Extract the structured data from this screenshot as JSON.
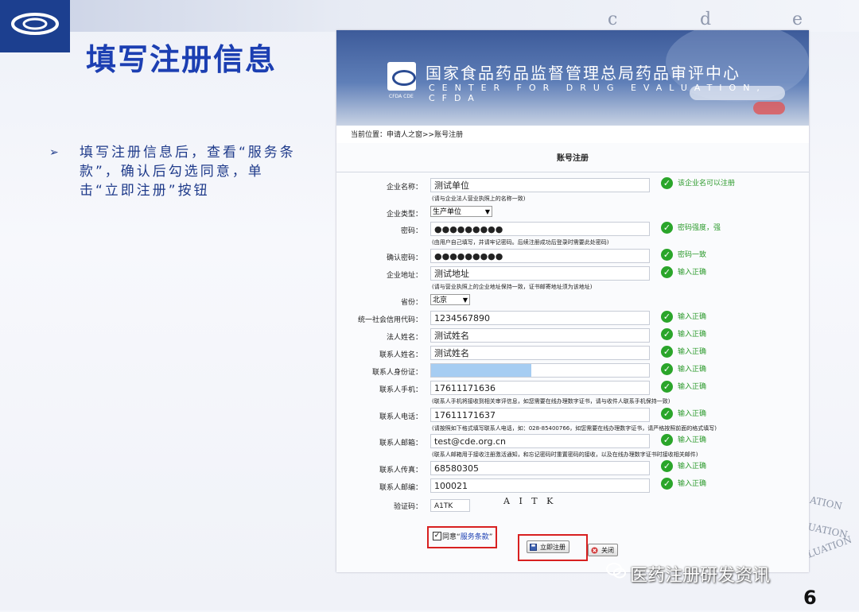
{
  "slide": {
    "title": "填写注册信息",
    "bullet": "填写注册信息后，查看“服务条款”，确认后勾选同意，单击“立即注册”按钮",
    "watermark_letters": [
      "c",
      "d",
      "e"
    ],
    "corner_words": [
      "ATION",
      "LUATION",
      "VALUATION"
    ],
    "wechat_label": "医药注册研发资讯",
    "page_number": "6"
  },
  "site": {
    "name_cn": "国家食品药品监督管理总局药品审评中心",
    "name_en": "CENTER FOR DRUG EVALUATION, CFDA",
    "logo_caption": "CFDA CDE",
    "breadcrumb": "当前位置：申请人之窗>>账号注册"
  },
  "form": {
    "title": "账号注册",
    "fields": [
      {
        "label": "企业名称：",
        "value": "测试单位",
        "hint": "(请与企业法人营业执照上的名称一致)",
        "status": "该企业名可以注册"
      },
      {
        "label": "企业类型：",
        "value": "生产单位",
        "type": "select"
      },
      {
        "label": "密码：",
        "value": "●●●●●●●●●",
        "hint": "(由用户自己填写，并请牢记密码。后续注册成功后登录时需要此处密码)",
        "status": "密码强度，强"
      },
      {
        "label": "确认密码：",
        "value": "●●●●●●●●●",
        "status": "密码一致"
      },
      {
        "label": "企业地址：",
        "value": "测试地址",
        "hint": "(请与营业执照上的企业地址保持一致，证书邮寄地址须为该地址)",
        "status": "输入正确"
      },
      {
        "label": "省份：",
        "value": "北京",
        "type": "select"
      },
      {
        "label": "统一社会信用代码：",
        "value": "1234567890",
        "status": "输入正确"
      },
      {
        "label": "法人姓名：",
        "value": "测试姓名",
        "status": "输入正确"
      },
      {
        "label": "联系人姓名：",
        "value": "测试姓名",
        "status": "输入正确"
      },
      {
        "label": "联系人身份证：",
        "value": "",
        "redacted": true,
        "status": "输入正确"
      },
      {
        "label": "联系人手机：",
        "value": "17611171636",
        "hint": "(联系人手机将接收到相关审评信息，如您需要在线办理数字证书，请与收件人联系手机保持一致)",
        "status": "输入正确"
      },
      {
        "label": "联系人电话：",
        "value": "17611171637",
        "hint": "(请按照如下格式填写联系人电话，如：028-85400766，如您需要在线办理数字证书，请严格按照前面的格式填写)",
        "status": "输入正确"
      },
      {
        "label": "联系人邮箱：",
        "value": "test@cde.org.cn",
        "hint": "(联系人邮箱用于接收注册激活通知，和忘记密码时重置密码的接收，以及在线办理数字证书时接收相关邮件)",
        "status": "输入正确"
      },
      {
        "label": "联系人传真：",
        "value": "68580305",
        "status": "输入正确"
      },
      {
        "label": "联系人邮编：",
        "value": "100021",
        "status": "输入正确"
      }
    ],
    "captcha_label": "验证码：",
    "captcha_value": "A1TK",
    "captcha_image_text": "A I T K",
    "agree_prefix": "同意",
    "agree_link": "服务条款",
    "submit_label": "立即注册",
    "close_label": "关闭",
    "check_glyph": "✓",
    "agree_mark": "✓",
    "select_arrow": "▼"
  },
  "colors": {
    "title_blue": "#1c3fb2",
    "ok_green": "#2aa52a",
    "highlight_red": "#d82020",
    "banner_blue": "#3d5b9a"
  },
  "icons": {
    "bullet": "arrow-right-icon",
    "status": "check-circle-icon",
    "submit": "save-icon",
    "close": "close-icon",
    "wechat": "wechat-icon"
  }
}
